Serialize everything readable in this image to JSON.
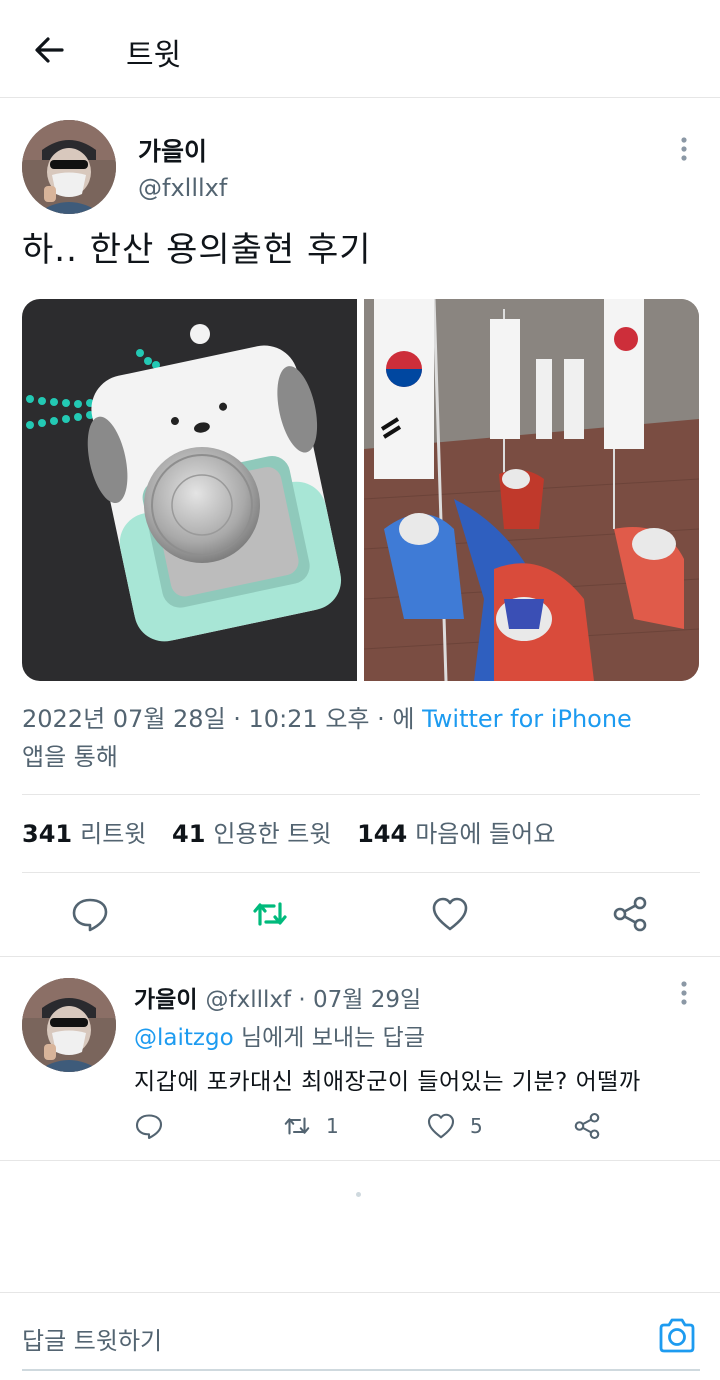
{
  "header": {
    "title": "트윗",
    "back_icon": "arrow-left-icon"
  },
  "tweet": {
    "author_name": "가을이",
    "author_handle": "@fxlllxf",
    "text": "하.. 한산 용의출현 후기",
    "timestamp": "2022년 07월 28일 · 10:21 오후 · 에",
    "source": "Twitter for iPhone",
    "via": "앱을 통해",
    "stats": {
      "retweets_count": "341",
      "retweets_label": "리트윗",
      "quotes_count": "41",
      "quotes_label": "인용한 트윗",
      "likes_count": "144",
      "likes_label": "마음에 들어요"
    },
    "actions": [
      "reply-icon",
      "retweet-icon",
      "heart-icon",
      "share-icon"
    ],
    "retweet_color": "#00ba7c"
  },
  "reply": {
    "author_name": "가을이",
    "meta": "@fxlllxf · 07월 29일",
    "mention": "@laitzgo",
    "reply_to_suffix": " 님에게 보내는 답글",
    "text": "지갑에 포카대신 최애장군이 들어있는 기분? 어떨까",
    "retweet_count": "1",
    "like_count": "5"
  },
  "compose": {
    "placeholder": "답글 트윗하기",
    "camera_icon": "camera-icon"
  },
  "colors": {
    "accent": "#1d9bf0",
    "text": "#0f1419",
    "muted": "#536471"
  }
}
